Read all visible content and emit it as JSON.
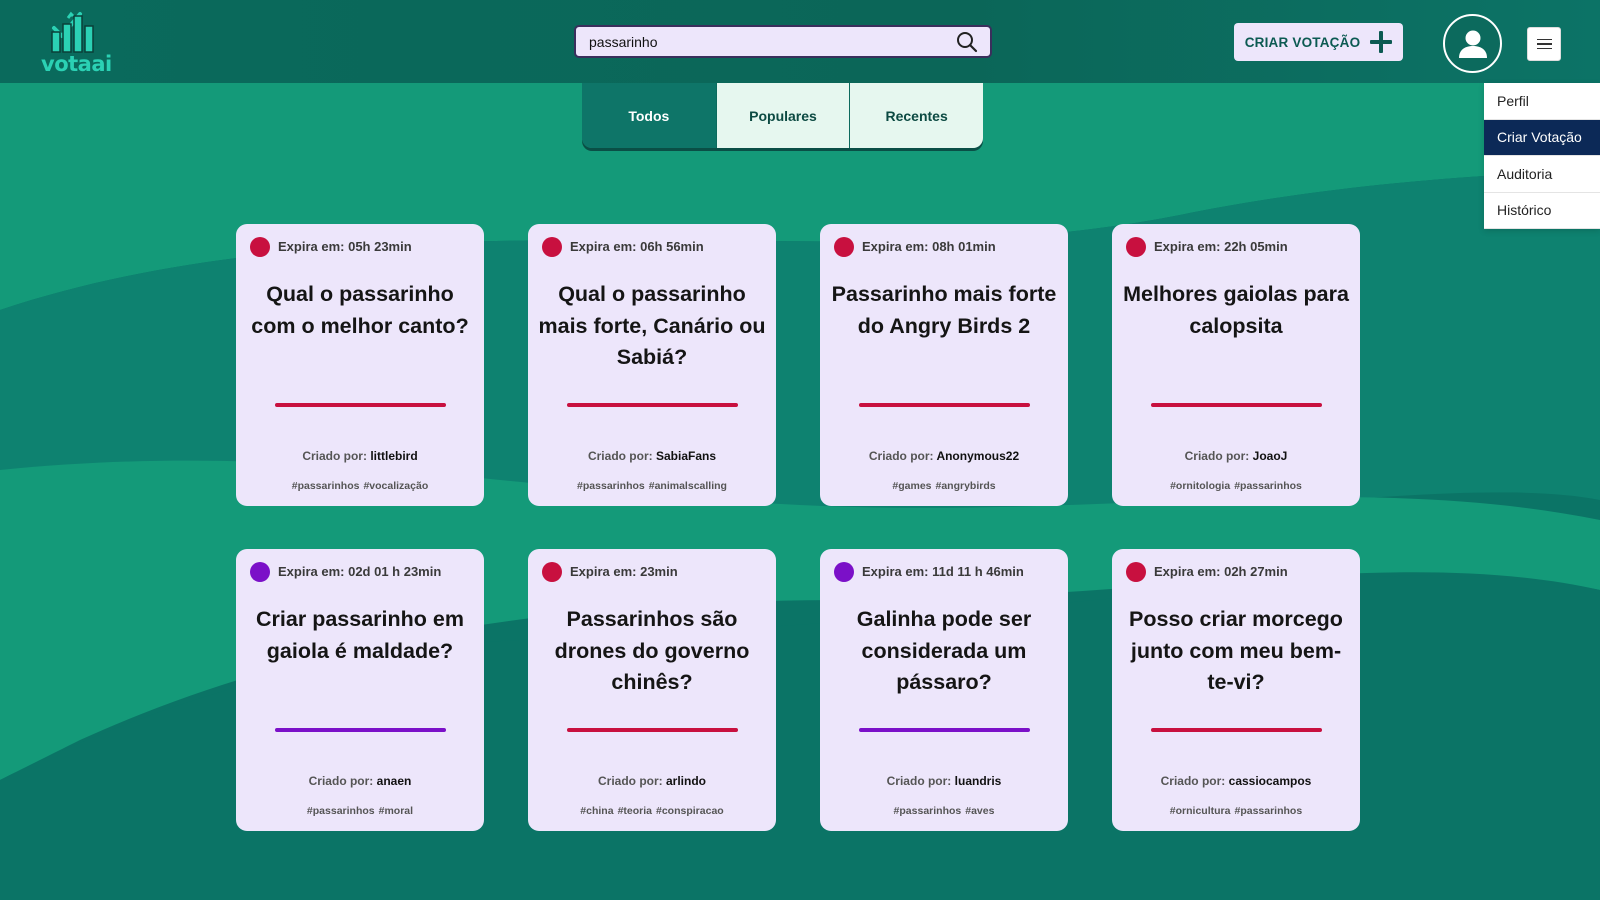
{
  "app": {
    "name": "votaai"
  },
  "search": {
    "value": "passarinho",
    "placeholder": ""
  },
  "header": {
    "create_label": "CRIAR VOTAÇÃO"
  },
  "menu": {
    "items": [
      {
        "label": "Perfil",
        "active": false
      },
      {
        "label": "Criar Votação",
        "active": true
      },
      {
        "label": "Auditoria",
        "active": false
      },
      {
        "label": "Histórico",
        "active": false
      }
    ]
  },
  "tabs": [
    {
      "label": "Todos",
      "active": true
    },
    {
      "label": "Populares",
      "active": false
    },
    {
      "label": "Recentes",
      "active": false
    }
  ],
  "colors": {
    "red": "#c8103f",
    "purple": "#7b10c8",
    "card_bg": "#ede6fb",
    "header_bg": "#0a6a5c",
    "body_light": "#149a79",
    "body_dark": "#0b7466",
    "menu_active": "#0c2957"
  },
  "author_prefix": "Criado por:",
  "cards": [
    {
      "expire": "Expira em: 05h 23min",
      "status_color": "#c8103f",
      "title": "Qual o passarinho com o melhor canto?",
      "author": "littlebird",
      "tags": [
        "#passarinhos",
        "#vocalização"
      ]
    },
    {
      "expire": "Expira em: 06h 56min",
      "status_color": "#c8103f",
      "title": "Qual o passarinho mais forte, Canário ou Sabiá?",
      "author": "SabiaFans",
      "tags": [
        "#passarinhos",
        "#animalscalling"
      ]
    },
    {
      "expire": "Expira em: 08h 01min",
      "status_color": "#c8103f",
      "title": "Passarinho mais forte do Angry Birds 2",
      "author": "Anonymous22",
      "tags": [
        "#games",
        "#angrybirds"
      ]
    },
    {
      "expire": "Expira em: 22h 05min",
      "status_color": "#c8103f",
      "title": "Melhores gaiolas para calopsita",
      "author": "JoaoJ",
      "tags": [
        "#ornitologia",
        "#passarinhos"
      ]
    },
    {
      "expire": "Expira em: 02d 01 h 23min",
      "status_color": "#7b10c8",
      "title": "Criar passarinho em gaiola é maldade?",
      "author": "anaen",
      "tags": [
        "#passarinhos",
        "#moral"
      ]
    },
    {
      "expire": "Expira em: 23min",
      "status_color": "#c8103f",
      "title": "Passarinhos são drones do governo chinês?",
      "author": "arlindo",
      "tags": [
        "#china",
        "#teoria",
        "#conspiracao"
      ]
    },
    {
      "expire": "Expira em: 11d 11 h 46min",
      "status_color": "#7b10c8",
      "title": "Galinha pode ser considerada um pássaro?",
      "author": "luandris",
      "tags": [
        "#passarinhos",
        "#aves"
      ]
    },
    {
      "expire": "Expira em: 02h 27min",
      "status_color": "#c8103f",
      "title": "Posso criar morcego junto com meu bem-te-vi?",
      "author": "cassiocampos",
      "tags": [
        "#ornicultura",
        "#passarinhos"
      ]
    }
  ]
}
